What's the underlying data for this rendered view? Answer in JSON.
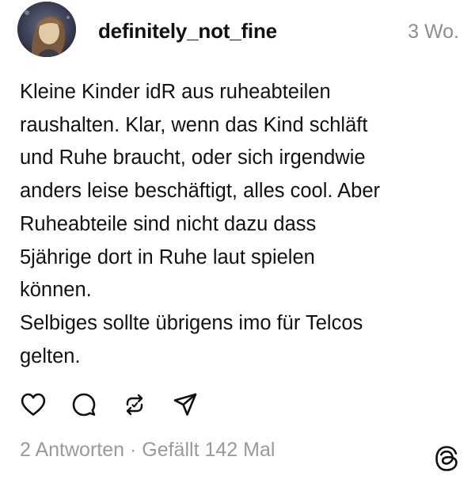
{
  "post": {
    "author": {
      "username": "definitely_not_fine",
      "avatar": "avatar-photo"
    },
    "time": "3 Wo.",
    "text_lines": [
      "Kleine Kinder idR aus ruheabteilen",
      "raushalten. Klar, wenn das Kind schläft",
      "und Ruhe braucht, oder sich irgendwie",
      "anders leise beschäftigt, alles cool. Aber",
      "Ruheabteile sind nicht dazu dass",
      "5jährige dort in Ruhe laut spielen",
      "können.",
      "Selbiges sollte übrigens imo für Telcos",
      "gelten."
    ],
    "actions": [
      {
        "icon": "heart-icon"
      },
      {
        "icon": "comment-icon"
      },
      {
        "icon": "repost-icon"
      },
      {
        "icon": "share-icon"
      }
    ],
    "stats": {
      "replies": "2 Antworten",
      "separator": "·",
      "likes": "Gefällt 142 Mal"
    },
    "brand_icon": "threads-logo-icon"
  }
}
